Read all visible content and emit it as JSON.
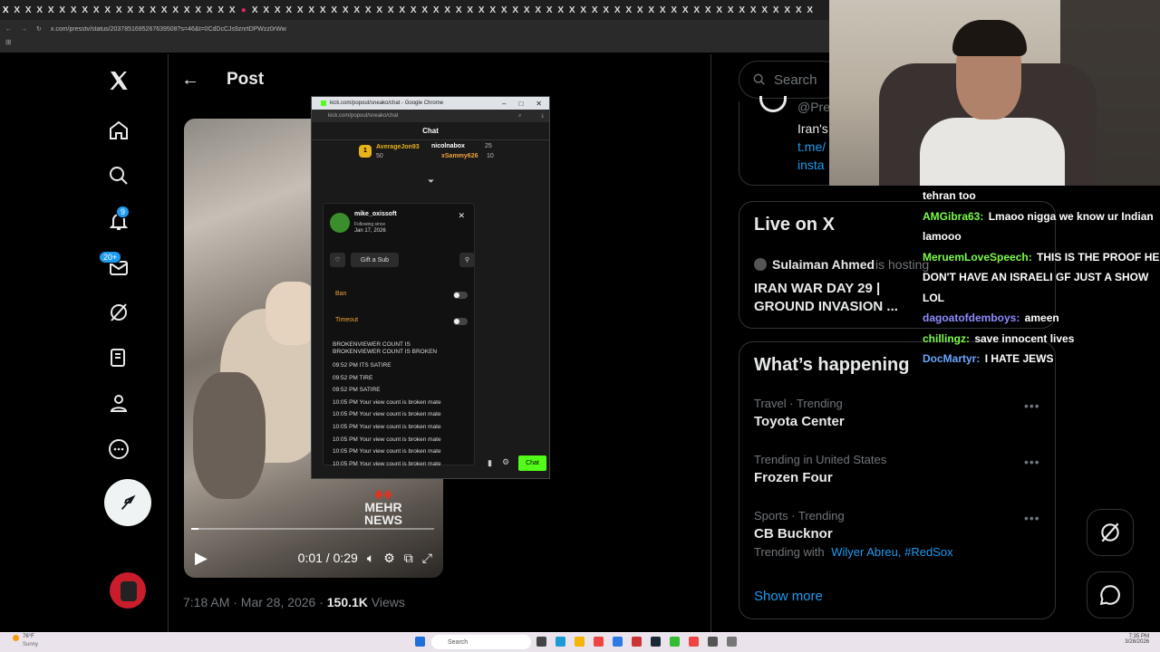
{
  "browser": {
    "tab_glyph": "X",
    "url": "x.com/presstv/status/2037851695267639508?s=46&t=0CdDcCJs9znrtDPWzz0rWw"
  },
  "nav": {
    "notifications_badge": "9",
    "messages_badge": "20+"
  },
  "post": {
    "title": "Post",
    "time": "0:01 / 0:29",
    "progress": 0.03,
    "watermark_name": "MEHR",
    "watermark_sub": "NEWS",
    "meta_date": "7:18 AM · Mar 28, 2026 · ",
    "views_count": "150.1K",
    "views_label": " Views"
  },
  "popup": {
    "window_title": "kick.com/popout/sneako/chat - Google Chrome",
    "url": "kick.com/popout/sneako/chat",
    "header": "Chat",
    "leaders": [
      {
        "name": "AverageJon93",
        "count": "50"
      },
      {
        "name": "nicolnabox",
        "count": "25"
      },
      {
        "name": "xSammy626",
        "count": "10"
      }
    ],
    "user_card": {
      "username": "mike_oxissoft",
      "following_since_label": "Following since",
      "following_since_date": "Jan 17, 2026",
      "gift_label": "Gift a Sub",
      "ban_label": "Ban",
      "timeout_label": "Timeout",
      "log": [
        "BROKENVIEWER COUNT IS",
        "BROKENVIEWER COUNT IS BROKEN",
        "09:52 PM ITS SATIRE",
        "09:52 PM TIRE",
        "09:52 PM SATIRE",
        "10:05 PM Your view count is broken mate",
        "10:05 PM Your view count is broken mate",
        "10:05 PM Your view count is broken mate",
        "10:05 PM Your view count is broken mate",
        "10:05 PM Your view count is broken mate",
        "10:05 PM Your view count is broken mate"
      ]
    },
    "chat_button": "Chat"
  },
  "right": {
    "search_placeholder": "Search",
    "profile_handle": "@Pre",
    "profile_text": "Iran's",
    "profile_link1": "t.me/",
    "profile_link2": "insta",
    "live_title": "Live on X",
    "live_host": "Sulaiman Ahmed",
    "live_host_suffix": " is hosting",
    "live_stream_title_1": "IRAN WAR DAY 29 |",
    "live_stream_title_2": "GROUND INVASION ...",
    "happening_title": "What’s happening",
    "trends": [
      {
        "category": "Travel · Trending",
        "name": "Toyota Center"
      },
      {
        "category": "Trending in United States",
        "name": "Frozen Four"
      },
      {
        "category": "Sports · Trending",
        "name": "CB Bucknor"
      }
    ],
    "trending_with_label": "Trending with",
    "trending_with_links": "Wilyer Abreu, #RedSox",
    "show_more": "Show more"
  },
  "stream_chat": [
    {
      "user": "",
      "text": "tehran too",
      "color": "#ffffff"
    },
    {
      "user": "AMGibra63:",
      "text": " Lmaoo nigga we know ur Indian lamooo",
      "color": "#7cfc4a"
    },
    {
      "user": "MeruemLoveSpeech:",
      "text": " THIS IS THE PROOF HE DON'T HAVE AN ISRAELI GF JUST A SHOW LOL",
      "color": "#7cfc4a"
    },
    {
      "user": "dagoatofdemboys:",
      "text": " ameen",
      "color": "#8f8cff"
    },
    {
      "user": "chillingz:",
      "text": " save innocent lives",
      "color": "#7cfc4a"
    },
    {
      "user": "DocMartyr:",
      "text": " I HATE JEWS",
      "color": "#6aa6ff"
    }
  ],
  "taskbar": {
    "weather_temp": "76°F",
    "weather_desc": "Sunny",
    "search_label": "Search",
    "time": "7:35 PM",
    "date": "3/28/2026"
  },
  "colors": {
    "x_blue": "#1d9bf0",
    "kick_green": "#53fc18",
    "ban_orange": "#f0a13a"
  }
}
